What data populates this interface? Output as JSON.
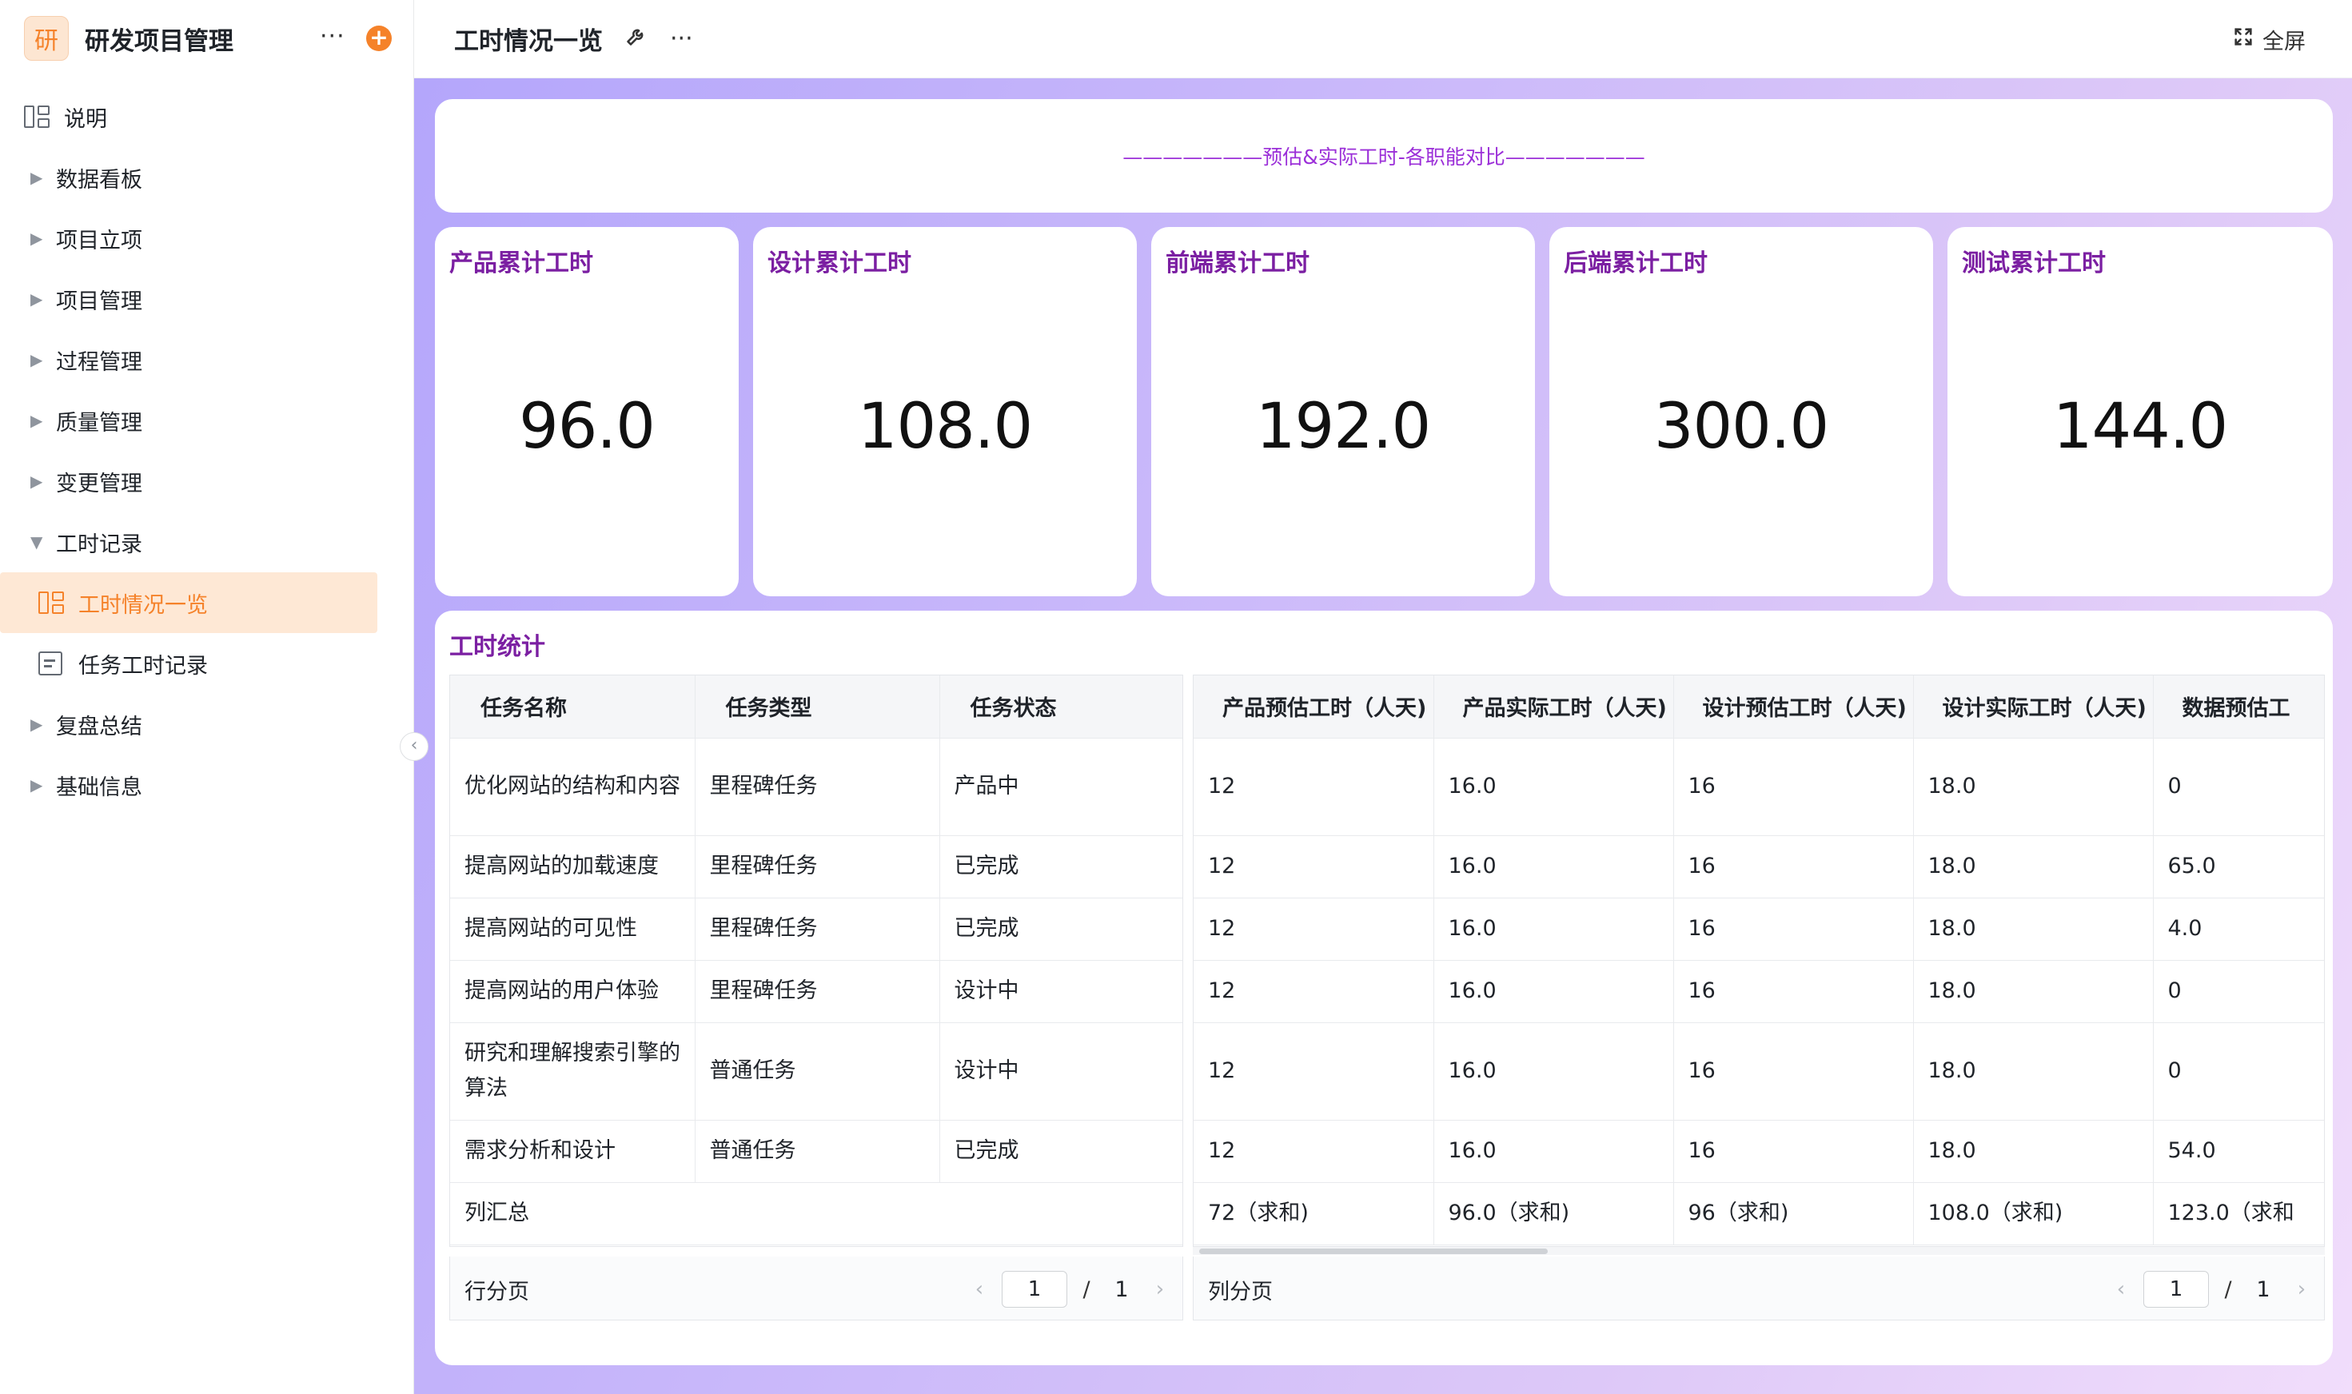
{
  "sidebar": {
    "logo_char": "研",
    "app_title": "研发项目管理",
    "more_icon": "···",
    "add_icon": "+",
    "items": [
      {
        "label": "说明"
      },
      {
        "label": "数据看板"
      },
      {
        "label": "项目立项"
      },
      {
        "label": "项目管理"
      },
      {
        "label": "过程管理"
      },
      {
        "label": "质量管理"
      },
      {
        "label": "变更管理"
      },
      {
        "label": "工时记录"
      },
      {
        "label": "工时情况一览"
      },
      {
        "label": "任务工时记录"
      },
      {
        "label": "复盘总结"
      },
      {
        "label": "基础信息"
      }
    ],
    "accent_color": "#f5822a"
  },
  "topbar": {
    "title": "工时情况一览",
    "more_icon": "···",
    "fullscreen_label": "全屏"
  },
  "banner": {
    "text": "———————预估&实际工时-各职能对比———————"
  },
  "metrics": [
    {
      "title": "产品累计工时",
      "value": "96.0"
    },
    {
      "title": "设计累计工时",
      "value": "108.0"
    },
    {
      "title": "前端累计工时",
      "value": "192.0"
    },
    {
      "title": "后端累计工时",
      "value": "300.0"
    },
    {
      "title": "测试累计工时",
      "value": "144.0"
    }
  ],
  "table": {
    "title": "工时统计",
    "frozen_headers": [
      "任务名称",
      "任务类型",
      "任务状态"
    ],
    "scroll_headers": [
      "产品预估工时（人天)",
      "产品实际工时（人天)",
      "设计预估工时（人天)",
      "设计实际工时（人天)",
      "数据预估工"
    ],
    "rows": [
      {
        "name": "优化网站的结构和内容",
        "type": "里程碑任务",
        "status": "产品中",
        "values": [
          "12",
          "16.0",
          "16",
          "18.0",
          "0"
        ]
      },
      {
        "name": "提高网站的加载速度",
        "type": "里程碑任务",
        "status": "已完成",
        "values": [
          "12",
          "16.0",
          "16",
          "18.0",
          "65.0"
        ]
      },
      {
        "name": "提高网站的可见性",
        "type": "里程碑任务",
        "status": "已完成",
        "values": [
          "12",
          "16.0",
          "16",
          "18.0",
          "4.0"
        ]
      },
      {
        "name": "提高网站的用户体验",
        "type": "里程碑任务",
        "status": "设计中",
        "values": [
          "12",
          "16.0",
          "16",
          "18.0",
          "0"
        ]
      },
      {
        "name": "研究和理解搜索引擎的算法",
        "type": "普通任务",
        "status": "设计中",
        "values": [
          "12",
          "16.0",
          "16",
          "18.0",
          "0"
        ]
      },
      {
        "name": "需求分析和设计",
        "type": "普通任务",
        "status": "已完成",
        "values": [
          "12",
          "16.0",
          "16",
          "18.0",
          "54.0"
        ]
      }
    ],
    "summary": {
      "label": "列汇总",
      "values": [
        "72（求和)",
        "96.0（求和)",
        "96（求和)",
        "108.0（求和)",
        "123.0（求和"
      ]
    }
  },
  "pagers": {
    "row_label": "行分页",
    "col_label": "列分页",
    "row_current": "1",
    "row_total": "1",
    "col_current": "1",
    "col_total": "1",
    "separator": "/",
    "prev_icon": "‹",
    "next_icon": "›"
  },
  "colors": {
    "metric_title": "#7b1fa2",
    "banner_text": "#9b2fd8",
    "background_gradient_start": "#b4a6fb",
    "background_gradient_end": "#f1ddfb"
  }
}
